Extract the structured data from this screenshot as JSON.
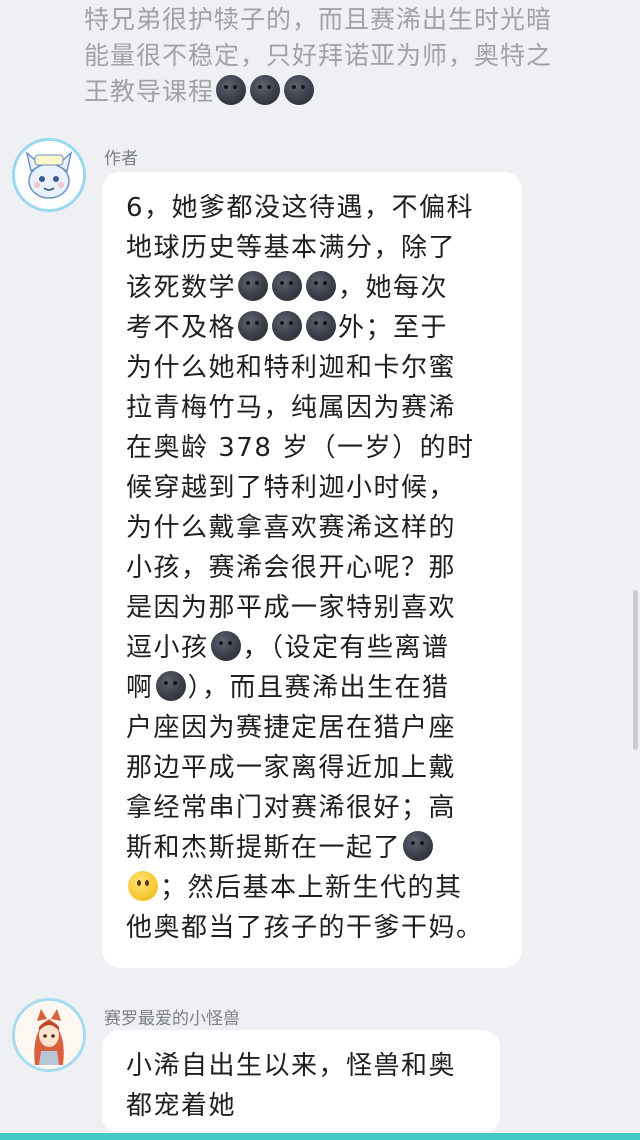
{
  "previous_message": {
    "lines": [
      "特兄弟很护犊子的，而且赛浠出生时光暗",
      "能量很不稳定，只好拜诺亚为师，奥特之",
      "王教导课程"
    ],
    "trailing_emoji": [
      "new-moon-face",
      "new-moon-face",
      "new-moon-face"
    ]
  },
  "author_message": {
    "sender": "作者",
    "segments": {
      "l1": "6，她爹都没这待遇，不偏科",
      "l2": "地球历史等基本满分，除了",
      "l3a": "该死数学",
      "l3b": "，她每次",
      "l4a": "考不及格",
      "l4b": "外；至于",
      "l5": "为什么她和特利迦和卡尔蜜",
      "l6": "拉青梅竹马，纯属因为赛浠",
      "l7": "在奥龄 378 岁（一岁）的时",
      "l8": "候穿越到了特利迦小时候，",
      "l9": "为什么戴拿喜欢赛浠这样的",
      "l10": "小孩，赛浠会很开心呢？那",
      "l11": "是因为那平成一家特别喜欢",
      "l12a": "逗小孩",
      "l12b": "，（设定有些离谱",
      "l13a": "啊",
      "l13b": "），而且赛浠出生在猎",
      "l14": "户座因为赛捷定居在猎户座",
      "l15": "那边平成一家离得近加上戴",
      "l16": "拿经常串门对赛浠很好；高",
      "l17": "斯和杰斯提斯在一起了",
      "l18": "；然后基本上新生代的其",
      "l19": "他奥都当了孩子的干爹干妈。"
    },
    "emoji_names": [
      "new-moon-face",
      "slightly-smiling-face"
    ]
  },
  "reply_message": {
    "sender": "赛罗最爱的小怪兽",
    "lines": [
      "小浠自出生以来，怪兽和奥",
      "都宠着她"
    ]
  },
  "colors": {
    "background": "#eef0f3",
    "bubble": "#ffffff",
    "avatar_ring": "#9bd8ee",
    "bottom_bar": "#46c9c4",
    "faded_text": "#9fa2a8"
  }
}
